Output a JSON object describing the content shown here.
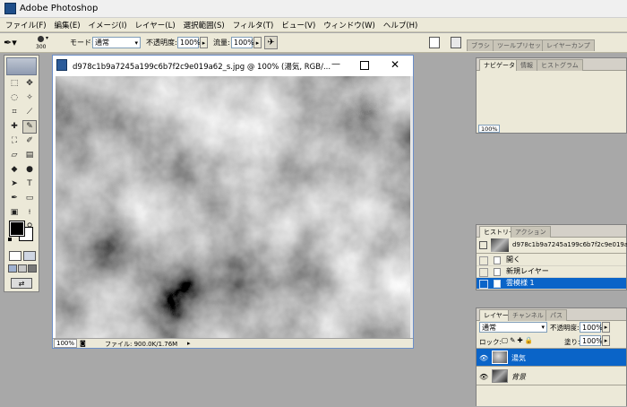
{
  "app": {
    "title": "Adobe Photoshop"
  },
  "menu": [
    "ファイル(F)",
    "編集(E)",
    "イメージ(I)",
    "レイヤー(L)",
    "選択範囲(S)",
    "フィルタ(T)",
    "ビュー(V)",
    "ウィンドウ(W)",
    "ヘルプ(H)"
  ],
  "options": {
    "brush_size": "300",
    "mode_label": "モード:",
    "mode_value": "通常",
    "opacity_label": "不透明度:",
    "opacity_value": "100%",
    "flow_label": "流量:",
    "flow_value": "100%"
  },
  "dock": {
    "tabs": [
      "ブラシ",
      "ツールプリセット",
      "レイヤーカンプ"
    ]
  },
  "document": {
    "title": "d978c1b9a7245a199c6b7f2c9e019a62_s.jpg @ 100% (湯気, RGB/...",
    "zoom": "100%",
    "file_info": "ファイル: 900.0K/1.76M"
  },
  "navigator": {
    "tabs": [
      "ナビゲータ",
      "情報",
      "ヒストグラム"
    ],
    "zoom": "100%"
  },
  "history": {
    "tabs": [
      "ヒストリー",
      "アクション"
    ],
    "snapshot": "d978c1b9a7245a199c6b7f2c9e019a62_s.jpg",
    "items": [
      "開く",
      "新規レイヤー",
      "雲模様 1"
    ],
    "selected_index": 2
  },
  "layers": {
    "tabs": [
      "レイヤー",
      "チャンネル",
      "パス"
    ],
    "blend_mode": "通常",
    "opacity_label": "不透明度:",
    "opacity_value": "100%",
    "lock_label": "ロック:",
    "fill_label": "塗り:",
    "fill_value": "100%",
    "items": [
      "湯気",
      "背景"
    ],
    "selected_index": 0
  },
  "colors": {
    "selection": "#0a64c8",
    "foreground": "#000000",
    "background": "#ffffff"
  }
}
